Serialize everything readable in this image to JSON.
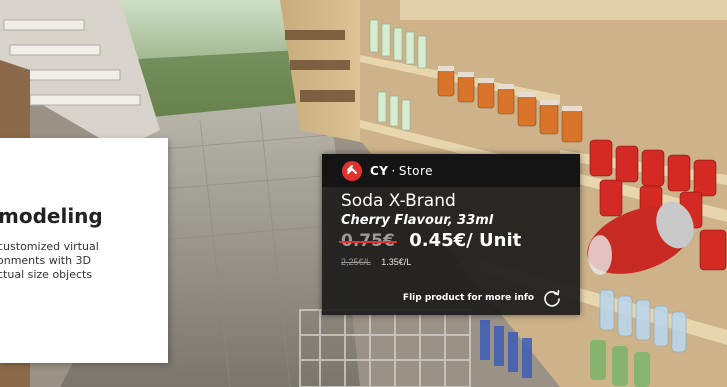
{
  "info_card": {
    "title": "modeling",
    "lines": [
      "customized virtual",
      "onments with 3D",
      "ctual size objects"
    ]
  },
  "price_card": {
    "brand": "CY",
    "brand_separator": "·",
    "brand_suffix": "Store",
    "product_name": "Soda X-Brand",
    "product_variant": "Cherry Flavour, 33ml",
    "old_price": "0.75€",
    "new_price": "0.45€/ Unit",
    "old_unit_price": "2,25€/L",
    "new_unit_price": "1.35€/L",
    "flip_hint": "Flip product for more info"
  },
  "colors": {
    "brand_red": "#e0332e",
    "panel_bg": "#1c1c1c",
    "card_bg": "#ffffff"
  },
  "icons": [
    "cy-store-logo-icon",
    "flip-rotate-icon"
  ]
}
